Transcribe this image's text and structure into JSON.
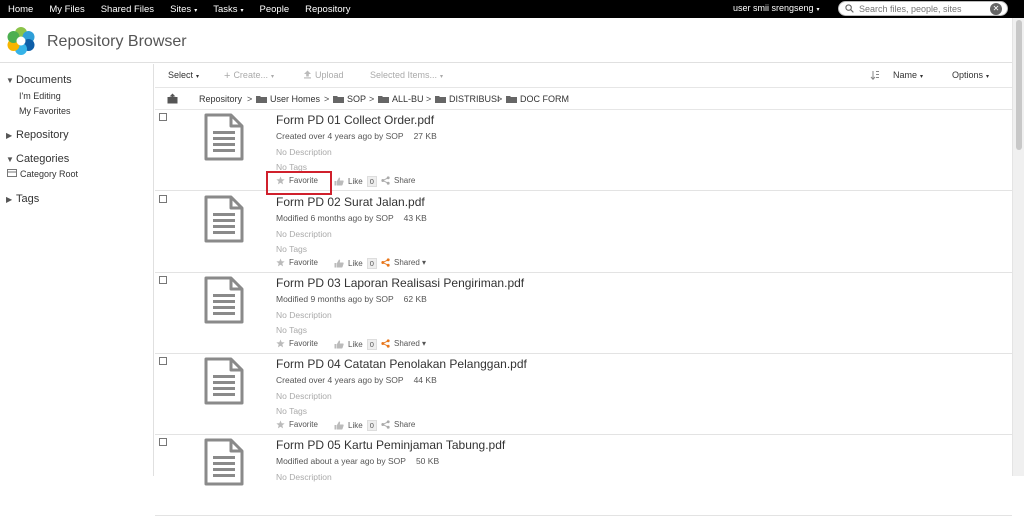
{
  "topnav": {
    "items": [
      {
        "label": "Home"
      },
      {
        "label": "My Files"
      },
      {
        "label": "Shared Files"
      },
      {
        "label": "Sites",
        "caret": "▾"
      },
      {
        "label": "Tasks",
        "caret": "▾"
      },
      {
        "label": "People"
      },
      {
        "label": "Repository"
      }
    ],
    "user": "user smii srengseng",
    "user_caret": "▾",
    "search_placeholder": "Search files, people, sites",
    "clear_glyph": "✕"
  },
  "header": {
    "title": "Repository Browser"
  },
  "leftnav": {
    "documents": "Documents",
    "im_editing": "I'm Editing",
    "my_favorites": "My Favorites",
    "repository": "Repository",
    "categories": "Categories",
    "category_root": "Category Root",
    "tags": "Tags",
    "expanded_glyph": "▼",
    "collapsed_glyph": "▶"
  },
  "toolbar": {
    "select": "Select",
    "create": "Create...",
    "upload": "Upload",
    "selected_items": "Selected Items...",
    "sort": "Name",
    "options": "Options",
    "caret": "▾",
    "plus": "+"
  },
  "breadcrumb": {
    "items": [
      "Repository",
      "User Homes",
      "SOP",
      "ALL-BU",
      "DISTRIBUSI",
      "DOC FORM"
    ],
    "separator": ">"
  },
  "files": [
    {
      "name": "Form PD 01 Collect Order.pdf",
      "meta": "Created over 4 years ago by SOP",
      "size": "27 KB",
      "description": "No Description",
      "tags": "No Tags",
      "favorite": "Favorite",
      "like": "Like",
      "likes": "0",
      "share": "Share",
      "shared": false
    },
    {
      "name": "Form PD 02 Surat Jalan.pdf",
      "meta": "Modified 6 months ago by SOP",
      "size": "43 KB",
      "description": "No Description",
      "tags": "No Tags",
      "favorite": "Favorite",
      "like": "Like",
      "likes": "0",
      "share": "Shared ▾",
      "shared": true
    },
    {
      "name": "Form PD 03 Laporan Realisasi Pengiriman.pdf",
      "meta": "Modified 9 months ago by SOP",
      "size": "62 KB",
      "description": "No Description",
      "tags": "No Tags",
      "favorite": "Favorite",
      "like": "Like",
      "likes": "0",
      "share": "Shared ▾",
      "shared": true
    },
    {
      "name": "Form PD 04 Catatan Penolakan Pelanggan.pdf",
      "meta": "Created over 4 years ago by SOP",
      "size": "44 KB",
      "description": "No Description",
      "tags": "No Tags",
      "favorite": "Favorite",
      "like": "Like",
      "likes": "0",
      "share": "Share",
      "shared": false
    },
    {
      "name": "Form PD 05 Kartu Peminjaman Tabung.pdf",
      "meta": "Modified about a year ago by SOP",
      "size": "50 KB",
      "description": "No Description",
      "tags": "",
      "favorite": "",
      "like": "",
      "likes": "",
      "share": "",
      "shared": false
    }
  ],
  "colors": {
    "shared_accent": "#e8761a",
    "highlight": "#d0202c",
    "folder": "#666666"
  }
}
